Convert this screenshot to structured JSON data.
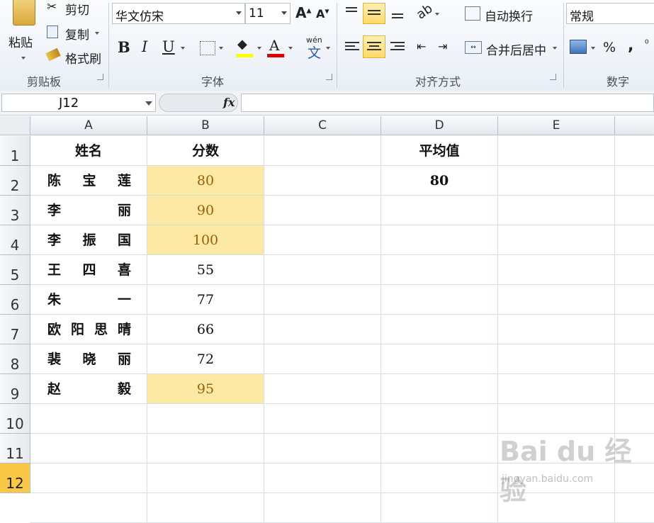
{
  "ribbon": {
    "clipboard": {
      "paste": "粘贴",
      "cut": "剪切",
      "copy": "复制",
      "format_painter": "格式刷",
      "group_label": "剪贴板"
    },
    "font": {
      "name": "华文仿宋",
      "size": "11",
      "bold": "B",
      "italic": "I",
      "underline": "U",
      "wen": "wén",
      "wen_char": "文",
      "group_label": "字体"
    },
    "alignment": {
      "wrap_text": "自动换行",
      "merge_center": "合并后居中",
      "group_label": "对齐方式"
    },
    "number": {
      "format": "常规",
      "percent": "%",
      "comma": ",",
      "group_label": "数字"
    },
    "colors": {
      "highlight": "#ffff00",
      "font_color": "#e00000",
      "active_fill": "#ffd966"
    }
  },
  "formula_bar": {
    "name_box": "J12",
    "fx": "fx",
    "value": ""
  },
  "columns": [
    "A",
    "B",
    "C",
    "D",
    "E"
  ],
  "rows": [
    "1",
    "2",
    "3",
    "4",
    "5",
    "6",
    "7",
    "8",
    "9",
    "10",
    "11",
    "12"
  ],
  "cells": {
    "A1": "姓名",
    "B1": "分数",
    "D1": "平均值",
    "names": [
      [
        "陈",
        "宝",
        "莲"
      ],
      [
        "李",
        "丽"
      ],
      [
        "李",
        "振",
        "国"
      ],
      [
        "王",
        "四",
        "喜"
      ],
      [
        "朱",
        "一"
      ],
      [
        "欧",
        "阳",
        "思",
        "晴"
      ],
      [
        "裴",
        "晓",
        "丽"
      ],
      [
        "赵",
        "毅"
      ]
    ],
    "scores": [
      "80",
      "90",
      "100",
      "55",
      "77",
      "66",
      "72",
      "95"
    ],
    "highlighted_scores": [
      true,
      true,
      true,
      false,
      false,
      false,
      false,
      true
    ],
    "D2": "80"
  },
  "highlight_color": "#fde9a3",
  "highlight_text_color": "#9b5e08",
  "watermark": {
    "brand": "Bai du 经验",
    "url": "jingyan.baidu.com"
  }
}
